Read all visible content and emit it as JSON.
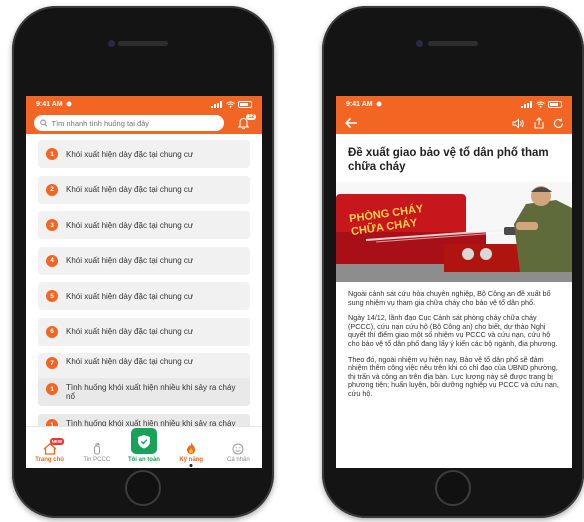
{
  "left_phone": {
    "status": {
      "time": "9:41 AM"
    },
    "search": {
      "placeholder": "Tìm nhanh tình huống tại đây"
    },
    "notification_badge": "12",
    "list_items": [
      {
        "number": "1",
        "label": "Khói xuất hiện dày đặc tại chung cư"
      },
      {
        "number": "2",
        "label": "Khói xuất hiện dày đặc tại chung cư"
      },
      {
        "number": "3",
        "label": "Khói xuất hiện dày đặc tại chung cư"
      },
      {
        "number": "4",
        "label": "Khói xuất hiện dày đặc tại chung cư"
      },
      {
        "number": "5",
        "label": "Khói xuất hiện dày đặc tại chung cư"
      },
      {
        "number": "6",
        "label": "Khói xuất hiện dày đặc tại chung cư"
      },
      {
        "number": "7",
        "label": "Khói xuất hiện dày đặc tại chung cư"
      }
    ],
    "overlap_items": [
      {
        "number": "1",
        "label": "Tình huống khói xuất hiện nhiều khi sảy ra cháy nổ"
      },
      {
        "number": "1",
        "label": "Tình huống khói xuất hiện nhiều khi sảy ra cháy nổ"
      }
    ],
    "nav": {
      "home": "Trang chủ",
      "home_badge": "NEW",
      "news": "Tin PCCC",
      "safety": "Tôi an toàn",
      "skills": "Kỹ năng",
      "profile": "Cá nhân"
    },
    "colors": {
      "accent": "#f26522",
      "green": "#19a35a"
    }
  },
  "right_phone": {
    "status": {
      "time": "9:41 AM"
    },
    "article": {
      "title": "Đề xuất giao bảo vệ tổ dân phố tham chữa cháy",
      "hero_sign_line1": "PHÒNG CHÁY",
      "hero_sign_line2": "CHỮA CHÁY",
      "paragraphs": [
        "Ngoài cảnh sát cứu hỏa chuyên nghiệp, Bộ Công an đề xuất bổ sung nhiệm vụ tham gia chữa cháy cho bảo vệ tổ dân phố.",
        "Ngày 14/12, lãnh đạo Cục Cảnh sát phòng cháy chữa cháy (PCCC), cứu nạn cứu hộ (Bộ Công an) cho biết, dự thảo Nghị quyết thí điểm giao một số nhiệm vụ PCCC và cứu nạn, cứu hộ cho bảo vệ tổ dân phố đang lấy ý kiến các bộ ngành, địa phương.",
        "Theo đó, ngoài nhiệm vụ hiện nay, Bảo vệ tổ dân phố sẽ đảm nhiệm thêm công việc nêu trên khi có chỉ đạo của UBND phường, thị trấn và công an trên địa bàn. Lực lượng này sẽ được trang bị phương tiện; huấn luyện, bồi dưỡng nghiệp vụ PCCC và cứu nạn, cứu hộ."
      ]
    }
  }
}
